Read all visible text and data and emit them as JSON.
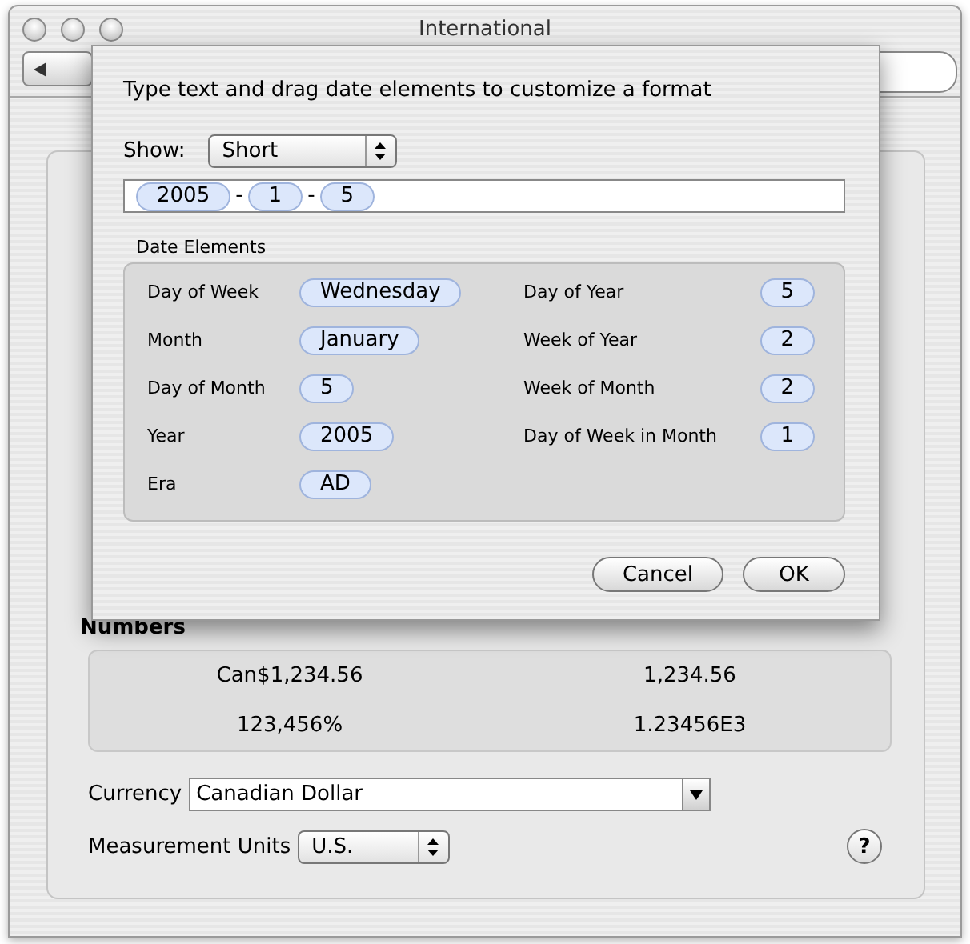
{
  "window": {
    "title": "International"
  },
  "numbers": {
    "title": "Numbers",
    "cells": [
      "Can$1,234.56",
      "1,234.56",
      "123,456%",
      "1.23456E3"
    ]
  },
  "currency": {
    "label": "Currency",
    "value": "Canadian Dollar"
  },
  "measurement": {
    "label": "Measurement Units",
    "value": "U.S."
  },
  "help": {
    "label": "?"
  },
  "sheet": {
    "instruction": "Type text and drag date elements to customize a format",
    "show": {
      "label": "Show:",
      "value": "Short"
    },
    "format_tokens": [
      {
        "kind": "element",
        "text": "2005"
      },
      {
        "kind": "separator",
        "text": "-"
      },
      {
        "kind": "element",
        "text": "1"
      },
      {
        "kind": "separator",
        "text": "-"
      },
      {
        "kind": "element",
        "text": "5"
      }
    ],
    "date_elements": {
      "title": "Date Elements",
      "left": [
        {
          "label": "Day of Week",
          "token": "Wednesday"
        },
        {
          "label": "Month",
          "token": "January"
        },
        {
          "label": "Day of Month",
          "token": "5"
        },
        {
          "label": "Year",
          "token": "2005"
        },
        {
          "label": "Era",
          "token": "AD"
        }
      ],
      "right": [
        {
          "label": "Day of Year",
          "token": "5"
        },
        {
          "label": "Week of Year",
          "token": "2"
        },
        {
          "label": "Week of Month",
          "token": "2"
        },
        {
          "label": "Day of Week in Month",
          "token": "1"
        }
      ]
    },
    "buttons": [
      "Cancel",
      "OK"
    ]
  }
}
